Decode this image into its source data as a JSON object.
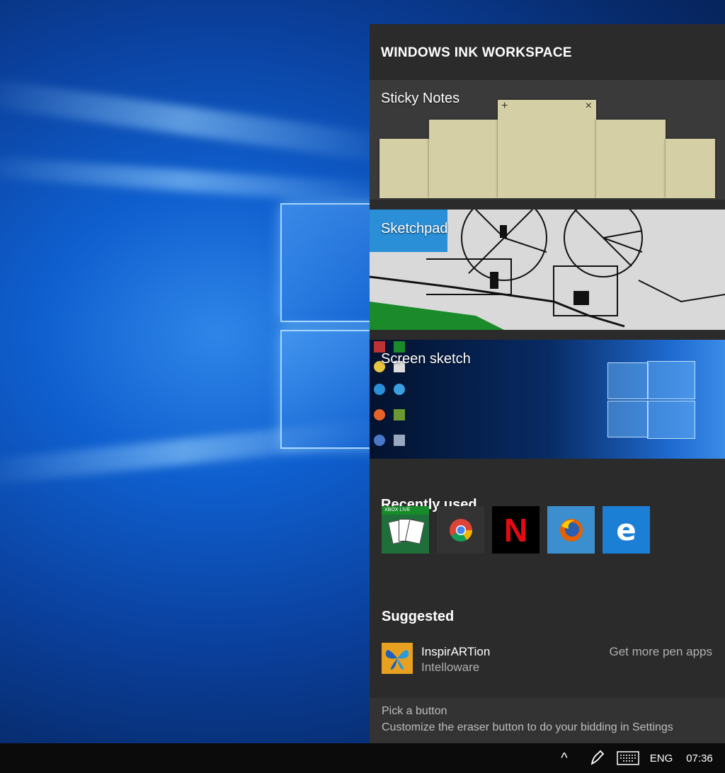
{
  "panel": {
    "title": "WINDOWS INK WORKSPACE",
    "tiles": {
      "sticky_notes": "Sticky Notes",
      "sketchpad": "Sketchpad",
      "screen_sketch": "Screen sketch"
    },
    "sticky_note_controls": {
      "add": "+",
      "close": "×"
    },
    "recently_used": {
      "title": "Recently used",
      "apps": [
        {
          "name": "Microsoft Solitaire Collection",
          "badge": "XBOX LIVE",
          "color": "#1f6f3a"
        },
        {
          "name": "Google Chrome",
          "color": "#333333"
        },
        {
          "name": "Netflix",
          "letter": "N",
          "color": "#000000"
        },
        {
          "name": "Mozilla Firefox",
          "color": "#3b8fcf"
        },
        {
          "name": "Microsoft Edge",
          "letter": "e",
          "color": "#1b7fd6"
        }
      ]
    },
    "suggested": {
      "title": "Suggested",
      "app_name": "InspirARTion",
      "publisher": "Intelloware",
      "more_link": "Get more pen apps"
    },
    "tip": {
      "title": "Pick a button",
      "text": "Customize the eraser button to do your bidding in Settings"
    }
  },
  "taskbar": {
    "chevron": "^",
    "language": "ENG",
    "time": "07:36"
  },
  "colors": {
    "panel_bg": "#2b2b2b",
    "sticky_note": "#d4cfa4",
    "taskbar": "#0b0b0b"
  }
}
